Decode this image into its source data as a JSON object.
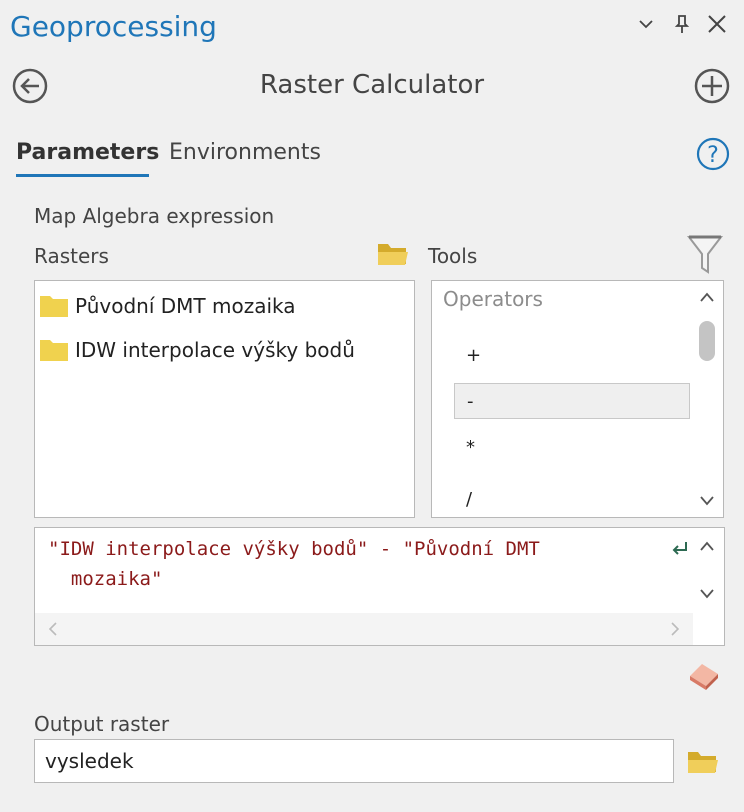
{
  "pane": {
    "title": "Geoprocessing"
  },
  "tool": {
    "title": "Raster Calculator"
  },
  "tabs": [
    {
      "label": "Parameters"
    },
    {
      "label": "Environments"
    }
  ],
  "expression": {
    "label": "Map Algebra expression",
    "rasters_label": "Rasters",
    "tools_label": "Tools",
    "rasters": [
      {
        "label": "Původní DMT mozaika"
      },
      {
        "label": "IDW interpolace výšky bodů"
      }
    ],
    "operators_header": "Operators",
    "operators": [
      {
        "label": "+"
      },
      {
        "label": "-"
      },
      {
        "label": "*"
      },
      {
        "label": "/"
      }
    ],
    "selected_operator": "-",
    "text": "\"IDW interpolace výšky bodů\" - \"Původní DMT\n  mozaika\""
  },
  "output": {
    "label": "Output raster",
    "value": "vysledek"
  },
  "colors": {
    "accent": "#1f76b8",
    "folder": "#e8c64b",
    "expression_text": "#8b1a1a"
  },
  "icons": [
    "back-icon",
    "add-icon",
    "help-icon",
    "folder-icon",
    "filter-icon",
    "eraser-icon",
    "word-wrap-icon",
    "chevron-down-icon",
    "pin-icon",
    "close-icon"
  ]
}
